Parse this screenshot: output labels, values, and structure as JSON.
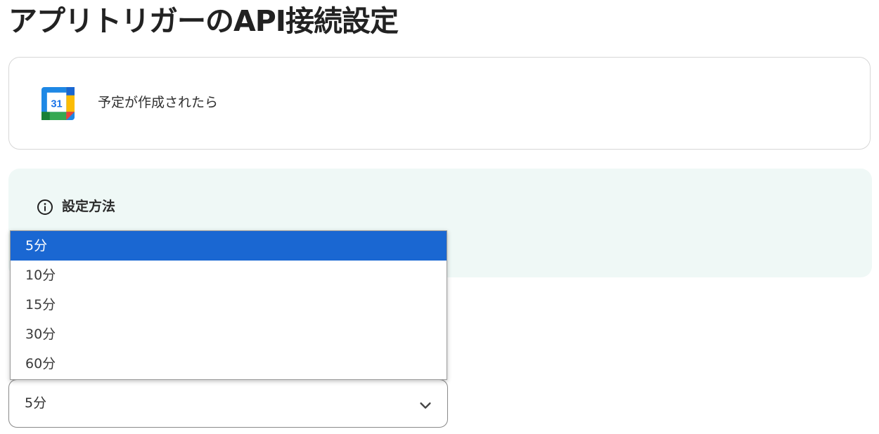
{
  "page": {
    "title": "アプリトリガーのAPI接続設定"
  },
  "trigger": {
    "icon": "google-calendar-icon",
    "icon_text": "31",
    "label": "予定が作成されたら"
  },
  "info": {
    "icon": "info-circle-icon",
    "title": "設定方法"
  },
  "interval_select": {
    "selected_value": "5分",
    "options": [
      "5分",
      "10分",
      "15分",
      "30分",
      "60分"
    ],
    "highlighted_index": 0
  },
  "colors": {
    "highlight": "#1a67d2",
    "info_background": "#eff8f6",
    "card_border": "#d7d7d7"
  }
}
